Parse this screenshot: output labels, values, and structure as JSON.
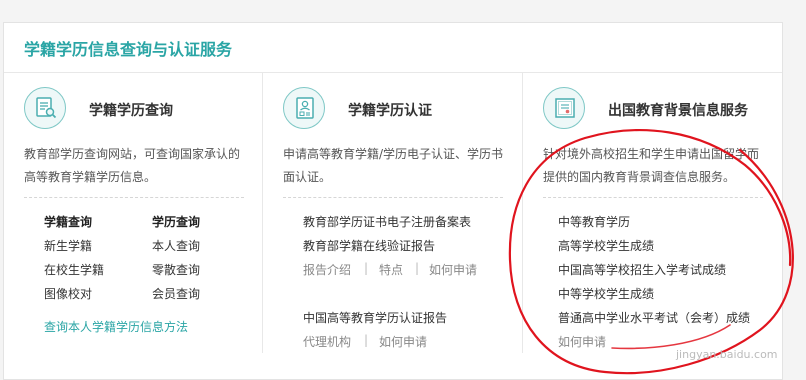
{
  "panel": {
    "title": "学籍学历信息查询与认证服务"
  },
  "columns": [
    {
      "heading": "学籍学历查询",
      "icon": "document-search-icon",
      "desc": "教育部学历查询网站，可查询国家承认的高等教育学籍学历信息。",
      "groups": [
        {
          "header": "学籍查询",
          "items": [
            "新生学籍",
            "在校生学籍",
            "图像校对"
          ]
        },
        {
          "header": "学历查询",
          "items": [
            "本人查询",
            "零散查询",
            "会员查询"
          ]
        }
      ],
      "footer_link": "查询本人学籍学历信息方法"
    },
    {
      "heading": "学籍学历认证",
      "icon": "id-card-icon",
      "desc": "申请高等教育学籍/学历电子认证、学历书面认证。",
      "links": [
        "教育部学历证书电子注册备案表",
        "教育部学籍在线验证报告"
      ],
      "sublinks1": [
        "报告介绍",
        "特点",
        "如何申请"
      ],
      "link3": "中国高等教育学历认证报告",
      "sublinks2": [
        "代理机构",
        "如何申请"
      ],
      "separator": "|"
    },
    {
      "heading": "出国教育背景信息服务",
      "icon": "certificate-icon",
      "desc": "针对境外高校招生和学生申请出国留学而提供的国内教育背景调查信息服务。",
      "links": [
        "中等教育学历",
        "高等学校学生成绩",
        "中国高等学校招生入学考试成绩",
        "中等学校学生成绩",
        "普通高中学业水平考试（会考）成绩"
      ],
      "footer_link": "如何申请"
    }
  ],
  "watermark": "jingyan.baidu.com",
  "colors": {
    "accent": "#2aa5a5",
    "annotation": "#e0141e"
  }
}
